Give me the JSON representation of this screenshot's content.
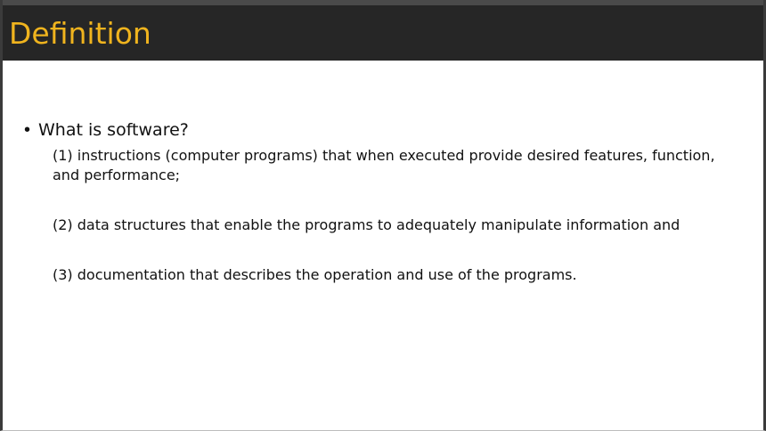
{
  "slide": {
    "title": "Definition",
    "bullet": {
      "text": "What is software?"
    },
    "items": [
      "(1) instructions (computer programs) that when executed provide desired features, function, and performance;",
      "(2) data structures that enable the programs to adequately manipulate information and",
      "(3) documentation that describes the operation and use of the programs."
    ]
  },
  "colors": {
    "title_bar": "#262626",
    "title_text": "#f0b41e",
    "body_text": "#111111",
    "background": "#ffffff"
  }
}
